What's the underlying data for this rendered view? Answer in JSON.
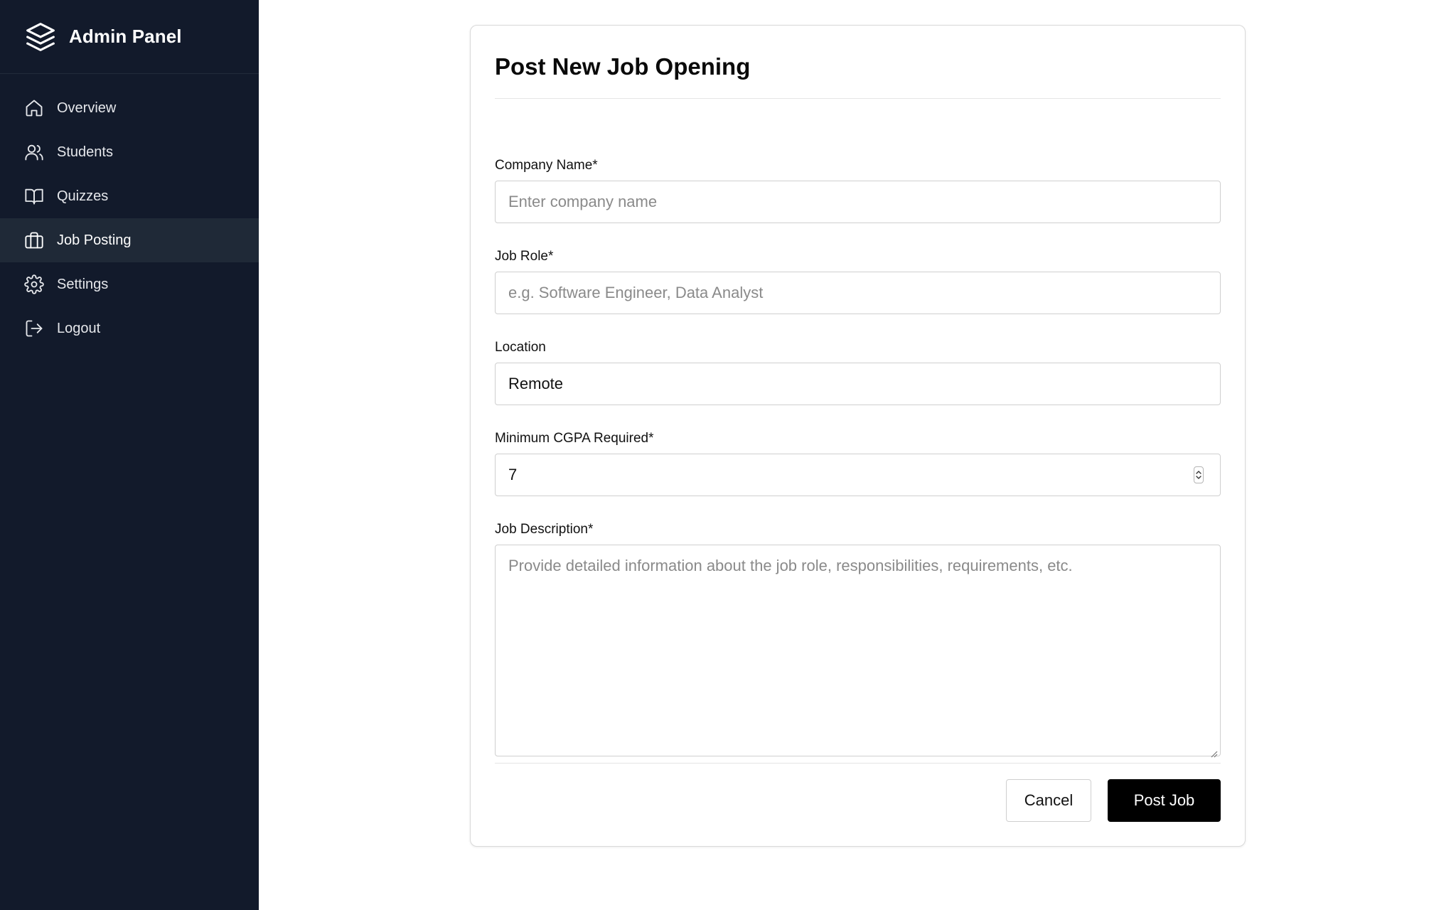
{
  "sidebar": {
    "brand": {
      "title": "Admin Panel",
      "icon": "layers-icon"
    },
    "items": [
      {
        "label": "Overview",
        "icon": "home-icon",
        "active": false
      },
      {
        "label": "Students",
        "icon": "users-icon",
        "active": false
      },
      {
        "label": "Quizzes",
        "icon": "book-open-icon",
        "active": false
      },
      {
        "label": "Job Posting",
        "icon": "briefcase-icon",
        "active": true
      },
      {
        "label": "Settings",
        "icon": "gear-icon",
        "active": false
      },
      {
        "label": "Logout",
        "icon": "logout-icon",
        "active": false
      }
    ]
  },
  "form": {
    "title": "Post New Job Opening",
    "company": {
      "label": "Company Name*",
      "placeholder": "Enter company name",
      "value": ""
    },
    "role": {
      "label": "Job Role*",
      "placeholder": "e.g. Software Engineer, Data Analyst",
      "value": ""
    },
    "location": {
      "label": "Location",
      "placeholder": "",
      "value": "Remote"
    },
    "cgpa": {
      "label": "Minimum CGPA Required*",
      "value": "7"
    },
    "description": {
      "label": "Job Description*",
      "placeholder": "Provide detailed information about the job role, responsibilities, requirements, etc.",
      "value": ""
    },
    "cancel_label": "Cancel",
    "submit_label": "Post Job"
  },
  "colors": {
    "sidebar_bg": "#121a2b",
    "sidebar_active_bg": "#1f2937",
    "primary_button": "#000000"
  }
}
